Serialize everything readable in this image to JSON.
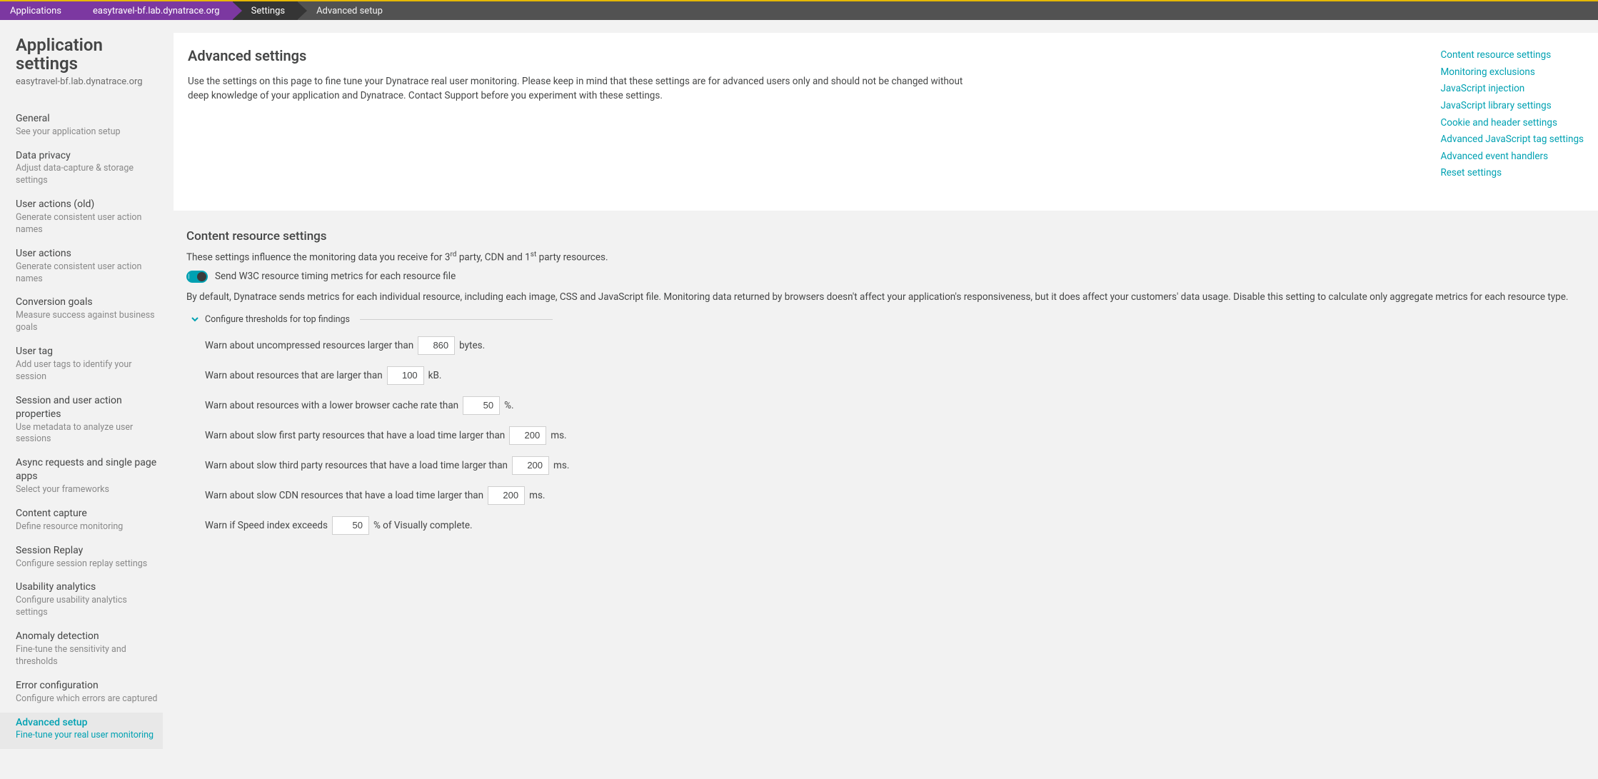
{
  "breadcrumb": {
    "applications": "Applications",
    "app_name": "easytravel-bf.lab.dynatrace.org",
    "settings": "Settings",
    "advanced": "Advanced setup"
  },
  "sidebar": {
    "title": "Application settings",
    "subtitle": "easytravel-bf.lab.dynatrace.org",
    "items": [
      {
        "t": "General",
        "d": "See your application setup"
      },
      {
        "t": "Data privacy",
        "d": "Adjust data-capture & storage settings"
      },
      {
        "t": "User actions (old)",
        "d": "Generate consistent user action names"
      },
      {
        "t": "User actions",
        "d": "Generate consistent user action names"
      },
      {
        "t": "Conversion goals",
        "d": "Measure success against business goals"
      },
      {
        "t": "User tag",
        "d": "Add user tags to identify your session"
      },
      {
        "t": "Session and user action properties",
        "d": "Use metadata to analyze user sessions"
      },
      {
        "t": "Async requests and single page apps",
        "d": "Select your frameworks"
      },
      {
        "t": "Content capture",
        "d": "Define resource monitoring"
      },
      {
        "t": "Session Replay",
        "d": "Configure session replay settings"
      },
      {
        "t": "Usability analytics",
        "d": "Configure usability analytics settings"
      },
      {
        "t": "Anomaly detection",
        "d": "Fine-tune the sensitivity and thresholds"
      },
      {
        "t": "Error configuration",
        "d": "Configure which errors are captured"
      },
      {
        "t": "Advanced setup",
        "d": "Fine-tune your real user monitoring"
      }
    ]
  },
  "main": {
    "title": "Advanced settings",
    "desc": "Use the settings on this page to fine tune your Dynatrace real user monitoring. Please keep in mind that these settings are for advanced users only and should not be changed without deep knowledge of your application and Dynatrace. Contact Support before you experiment with these settings.",
    "anchors": [
      "Content resource settings",
      "Monitoring exclusions",
      "JavaScript injection",
      "JavaScript library settings",
      "Cookie and header settings",
      "Advanced JavaScript tag settings",
      "Advanced event handlers",
      "Reset settings"
    ]
  },
  "content_resource": {
    "heading": "Content resource settings",
    "sub_pre": "These settings influence the monitoring data you receive for 3",
    "sub_mid": " party, CDN and 1",
    "sub_post": " party resources.",
    "sup1": "rd",
    "sup2": "st",
    "toggle_label": "Send W3C resource timing metrics for each resource file",
    "note": "By default, Dynatrace sends metrics for each individual resource, including each image, CSS and JavaScript file. Monitoring data returned by browsers doesn't affect your application's responsiveness, but it does affect your customers' data usage. Disable this setting to calculate only aggregate metrics for each resource type.",
    "expand_label": "Configure thresholds for top findings",
    "rows": [
      {
        "pre": "Warn about uncompressed resources larger than",
        "val": "860",
        "suf": "bytes."
      },
      {
        "pre": "Warn about resources that are larger than",
        "val": "100",
        "suf": "kB."
      },
      {
        "pre": "Warn about resources with a lower browser cache rate than",
        "val": "50",
        "suf": "%."
      },
      {
        "pre": "Warn about slow first party resources that have a load time larger than",
        "val": "200",
        "suf": "ms."
      },
      {
        "pre": "Warn about slow third party resources that have a load time larger than",
        "val": "200",
        "suf": "ms."
      },
      {
        "pre": "Warn about slow CDN resources that have a load time larger than",
        "val": "200",
        "suf": "ms."
      },
      {
        "pre": "Warn if Speed index exceeds",
        "val": "50",
        "suf": "% of Visually complete."
      }
    ]
  }
}
